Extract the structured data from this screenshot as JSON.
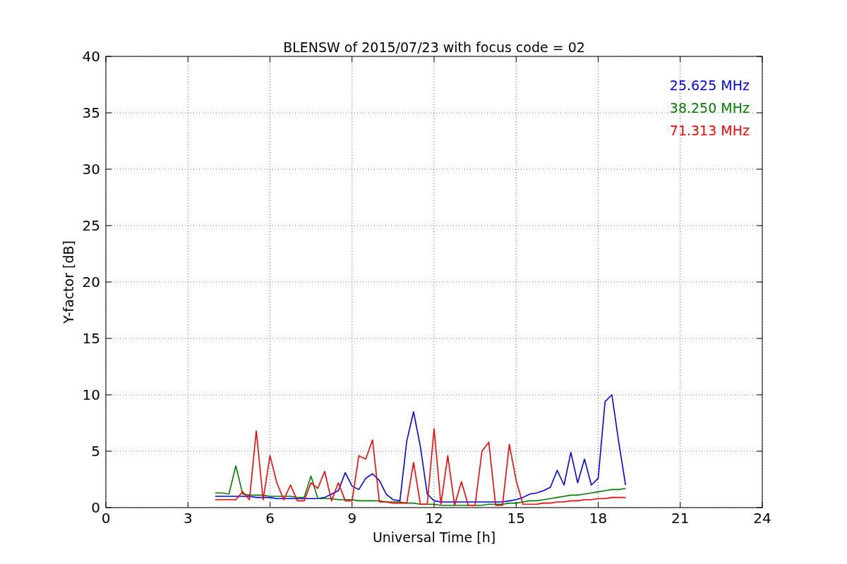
{
  "chart_data": {
    "type": "line",
    "title": "BLENSW of 2015/07/23 with focus code = 02",
    "xlabel": "Universal Time [h]",
    "ylabel": "Y-factor [dB]",
    "x": [
      4,
      4.25,
      4.5,
      4.75,
      5,
      5.25,
      5.5,
      5.75,
      6,
      6.25,
      6.5,
      6.75,
      7,
      7.25,
      7.5,
      7.75,
      8,
      8.25,
      8.5,
      8.75,
      9,
      9.25,
      9.5,
      9.75,
      10,
      10.25,
      10.5,
      10.75,
      11,
      11.25,
      11.5,
      11.75,
      12,
      12.25,
      12.5,
      12.75,
      13,
      13.25,
      13.5,
      13.75,
      14,
      14.25,
      14.5,
      14.75,
      15,
      15.25,
      15.5,
      15.75,
      16,
      16.25,
      16.5,
      16.75,
      17,
      17.25,
      17.5,
      17.75,
      18,
      18.25,
      18.5,
      18.75,
      19
    ],
    "series": [
      {
        "name": "25.625 MHz",
        "color": "#0000ff",
        "values": [
          1.0,
          1.0,
          1.0,
          1.0,
          1.0,
          1.0,
          0.9,
          0.9,
          0.9,
          0.8,
          0.8,
          0.8,
          0.8,
          0.8,
          0.8,
          0.8,
          0.9,
          1.2,
          1.5,
          3.1,
          1.9,
          1.6,
          2.6,
          3.0,
          2.4,
          1.2,
          0.7,
          0.6,
          5.9,
          8.5,
          5.4,
          1.2,
          0.6,
          0.5,
          0.5,
          0.5,
          0.5,
          0.5,
          0.5,
          0.5,
          0.5,
          0.5,
          0.5,
          0.6,
          0.7,
          0.9,
          1.2,
          1.3,
          1.5,
          1.8,
          3.3,
          2.0,
          4.9,
          2.2,
          4.3,
          2.0,
          2.6,
          9.4,
          10.0,
          5.8,
          2.0
        ]
      },
      {
        "name": "38.250 MHz",
        "color": "#008000",
        "values": [
          1.3,
          1.3,
          1.2,
          3.7,
          1.2,
          1.1,
          1.1,
          1.1,
          1.0,
          1.0,
          1.0,
          1.0,
          0.9,
          0.9,
          2.8,
          0.8,
          0.8,
          0.8,
          0.7,
          0.7,
          0.7,
          0.6,
          0.6,
          0.6,
          0.6,
          0.5,
          0.5,
          0.5,
          0.4,
          0.4,
          0.3,
          0.3,
          0.3,
          0.2,
          0.2,
          0.2,
          0.2,
          0.2,
          0.2,
          0.2,
          0.3,
          0.3,
          0.3,
          0.4,
          0.4,
          0.5,
          0.6,
          0.6,
          0.7,
          0.8,
          0.9,
          1.0,
          1.1,
          1.1,
          1.2,
          1.3,
          1.4,
          1.5,
          1.6,
          1.6,
          1.7
        ]
      },
      {
        "name": "71.313 MHz",
        "color": "#ff0000",
        "values": [
          0.7,
          0.7,
          0.7,
          0.7,
          1.4,
          0.7,
          6.8,
          0.7,
          4.6,
          2.2,
          0.7,
          2.0,
          0.6,
          0.6,
          2.2,
          1.7,
          3.2,
          0.6,
          2.2,
          0.6,
          0.6,
          4.6,
          4.3,
          6.0,
          0.5,
          0.5,
          0.4,
          0.4,
          0.4,
          4.0,
          0.3,
          0.3,
          7.0,
          0.3,
          4.6,
          0.2,
          2.3,
          0.2,
          0.2,
          5.0,
          5.8,
          0.2,
          0.2,
          5.6,
          2.4,
          0.3,
          0.3,
          0.3,
          0.4,
          0.4,
          0.5,
          0.5,
          0.6,
          0.6,
          0.7,
          0.7,
          0.8,
          0.8,
          0.9,
          0.9,
          0.9
        ]
      }
    ],
    "xlim": [
      0,
      24
    ],
    "ylim": [
      0,
      40
    ],
    "grid": true,
    "xticks": [
      0,
      3,
      6,
      9,
      12,
      15,
      18,
      21,
      24
    ],
    "yticks": [
      0,
      5,
      10,
      15,
      20,
      25,
      30,
      35,
      40
    ]
  }
}
